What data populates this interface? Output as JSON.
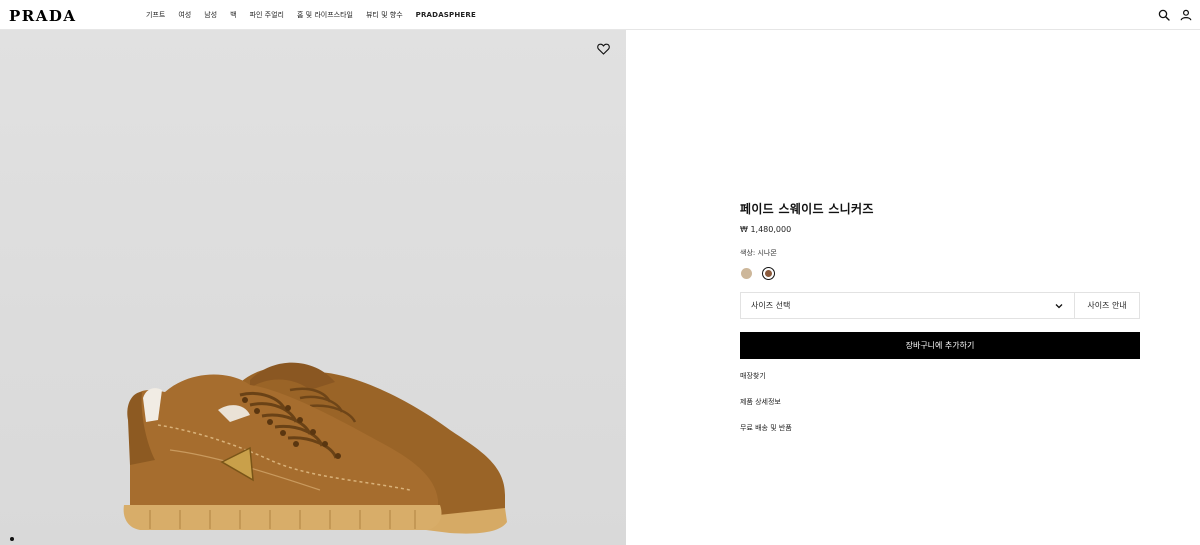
{
  "brand": {
    "logo_text": "PRADA"
  },
  "nav": {
    "items": [
      "기프트",
      "여성",
      "남성",
      "백",
      "파인 주얼리",
      "홈 및 라이프스타일",
      "뷰티 및 향수",
      "PRADASPHERE"
    ]
  },
  "header_icons": [
    "search-icon",
    "account-icon"
  ],
  "product": {
    "title": "페이드 스웨이드 스니커즈",
    "price": "₩ 1,480,000",
    "color_label": "색상: 시나몬",
    "swatches": [
      {
        "name": "beige",
        "color": "#cdb79a",
        "selected": false
      },
      {
        "name": "cinnamon",
        "color": "#8b5a3c",
        "selected": true
      }
    ],
    "size_select_label": "사이즈 선택",
    "size_guide_label": "사이즈 안내",
    "add_to_cart_label": "장바구니에 추가하기",
    "links": [
      "매장찾기",
      "제품 상세정보",
      "무료 배송 및 반품"
    ]
  },
  "colors": {
    "shoe_suede": "#a0692a",
    "shoe_sole": "#d4a862",
    "background": "#dedede"
  }
}
